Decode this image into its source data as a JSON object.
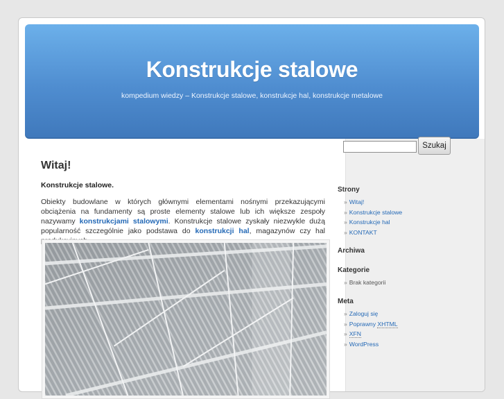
{
  "header": {
    "title": "Konstrukcje stalowe",
    "description": "kompedium wiedzy – Konstrukcje stalowe, konstrukcje hal, konstrukcje metalowe"
  },
  "post": {
    "title": "Witaj!",
    "intro_bold": "Konstrukcje stalowe.",
    "p_part1": "Obiekty budowlane w których głównymi elementami nośnymi przekazującymi obciążenia na fundamenty są proste elementy stalowe lub ich większe zespoły nazywamy ",
    "p_link1": "konstrukcjami stalowymi",
    "p_part2": ". Konstrukcje stalowe zyskały niezwykle dużą popularność szczególnie jako podstawa do ",
    "p_link2": "konstrukcji hal",
    "p_part3": ", magazynów czy hal produkcyjnych."
  },
  "search": {
    "value": "",
    "button_label": "Szukaj"
  },
  "sidebar": {
    "strony": {
      "heading": "Strony",
      "items": [
        "Witaj!",
        "Konstrukcje stalowe",
        "Konstrukcje hal",
        "KONTAKT"
      ]
    },
    "archiwa": {
      "heading": "Archiwa"
    },
    "kategorie": {
      "heading": "Kategorie",
      "items": [
        "Brak kategorii"
      ]
    },
    "meta": {
      "heading": "Meta",
      "login": "Zaloguj się",
      "xhtml_prefix": "Poprawny ",
      "xhtml_abbr": "XHTML",
      "xfn": "XFN",
      "wordpress": "WordPress"
    }
  },
  "colors": {
    "header_top": "#6cb0ea",
    "header_bottom": "#3f78bb",
    "link": "#2469b6",
    "sidebar_bg": "#efefef"
  }
}
